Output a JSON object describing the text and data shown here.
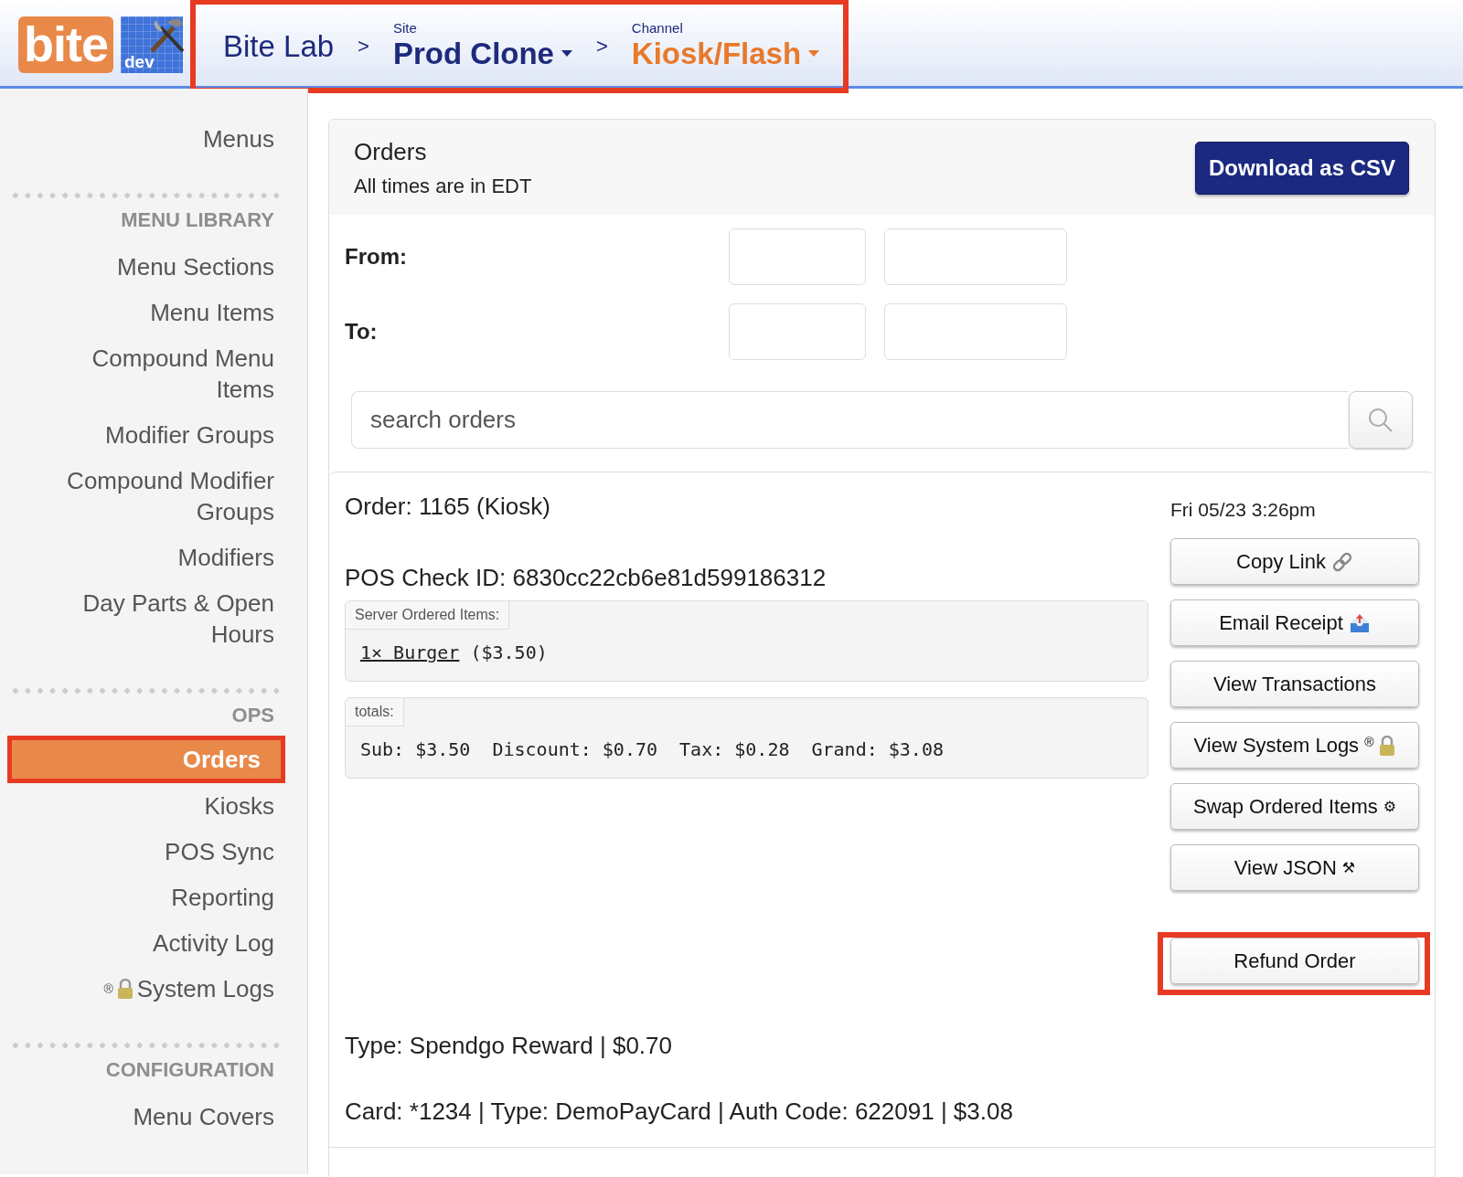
{
  "logo": {
    "text": "bite",
    "badge": "dev"
  },
  "breadcrumb": {
    "highlighted": true,
    "org": "Bite Lab",
    "separators": [
      ">",
      ">"
    ],
    "site": {
      "caption": "Site",
      "value": "Prod Clone"
    },
    "channel": {
      "caption": "Channel",
      "value": "Kiosk/Flash"
    }
  },
  "sidebar": {
    "sections": [
      {
        "items": [
          {
            "label": "Menus",
            "selected": false,
            "highlighted": false
          }
        ]
      },
      {
        "heading": "MENU LIBRARY",
        "items": [
          {
            "label": "Menu Sections",
            "selected": false,
            "highlighted": false
          },
          {
            "label": "Menu Items",
            "selected": false,
            "highlighted": false
          },
          {
            "label": "Compound Menu Items",
            "selected": false,
            "highlighted": false
          },
          {
            "label": "Modifier Groups",
            "selected": false,
            "highlighted": false
          },
          {
            "label": "Compound Modifier Groups",
            "selected": false,
            "highlighted": false
          },
          {
            "label": "Modifiers",
            "selected": false,
            "highlighted": false
          },
          {
            "label": "Day Parts & Open Hours",
            "selected": false,
            "highlighted": false
          }
        ]
      },
      {
        "heading": "OPS",
        "items": [
          {
            "label": "Orders",
            "selected": true,
            "highlighted": true
          },
          {
            "label": "Kiosks",
            "selected": false,
            "highlighted": false
          },
          {
            "label": "POS Sync",
            "selected": false,
            "highlighted": false
          },
          {
            "label": "Reporting",
            "selected": false,
            "highlighted": false
          },
          {
            "label": "Activity Log",
            "selected": false,
            "highlighted": false
          },
          {
            "label": "System Logs",
            "selected": false,
            "highlighted": false,
            "badge": "®",
            "locked": true
          }
        ]
      },
      {
        "heading": "CONFIGURATION",
        "items": [
          {
            "label": "Menu Covers",
            "selected": false,
            "highlighted": false
          }
        ]
      }
    ]
  },
  "orders_panel": {
    "title": "Orders",
    "subtitle": "All times are in EDT",
    "download_button": "Download as CSV",
    "filters": [
      {
        "label": "From:"
      },
      {
        "label": "To:"
      }
    ],
    "search": {
      "placeholder": "search orders"
    }
  },
  "order": {
    "title": "Order: 1165 (Kiosk)",
    "pos_check_id": "POS Check ID: 6830cc22cb6e81d599186312",
    "date": "Fri 05/23 3:26pm",
    "items_box": {
      "legend": "Server Ordered Items:",
      "items": [
        {
          "link": "1× Burger",
          "price": "($3.50)"
        }
      ]
    },
    "totals_box": {
      "legend": "totals:",
      "totals": [
        "Sub: $3.50",
        "Discount: $0.70",
        "Tax: $0.28",
        "Grand: $3.08"
      ]
    },
    "actions": [
      {
        "label": "Copy Link",
        "kind": "link"
      },
      {
        "label": "Email Receipt",
        "kind": "inbox"
      },
      {
        "label": "View Transactions",
        "kind": "plain"
      },
      {
        "label": "View System Logs",
        "kind": "locked",
        "badge": "®"
      },
      {
        "label": "Swap Ordered Items",
        "kind": "symbol",
        "symbol": "⚙"
      },
      {
        "label": "View JSON",
        "kind": "symbol",
        "symbol": "⚒"
      }
    ],
    "refund_button": {
      "label": "Refund Order",
      "highlighted": true
    },
    "payments": [
      "Type: Spendgo Reward | $0.70",
      "Card: *1234 | Type: DemoPayCard | Auth Code: 622091 | $3.08"
    ]
  }
}
